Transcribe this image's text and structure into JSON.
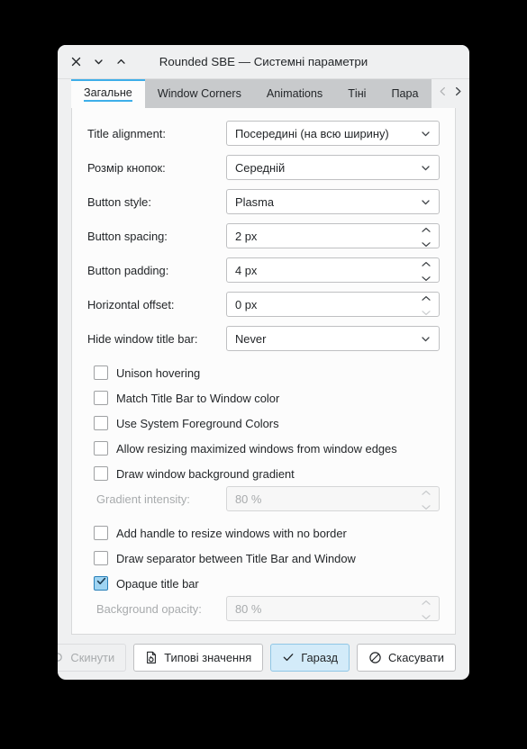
{
  "window": {
    "title": "Rounded SBE — Системні параметри",
    "controls": [
      {
        "name": "close",
        "glyph": "close-icon"
      },
      {
        "name": "minimize",
        "glyph": "chevron-down-icon"
      },
      {
        "name": "maximize",
        "glyph": "chevron-up-icon"
      }
    ]
  },
  "tabs": {
    "items": [
      {
        "label": "Загальне",
        "active": true
      },
      {
        "label": "Window Corners",
        "active": false
      },
      {
        "label": "Animations",
        "active": false
      },
      {
        "label": "Тіні",
        "active": false
      },
      {
        "label": "Пара",
        "active": false
      }
    ],
    "nav_prev": "chevron-left-icon",
    "nav_next": "chevron-right-icon"
  },
  "form": {
    "rows": [
      {
        "label": "Title alignment:",
        "value": "Посередині (на всю ширину)",
        "kind": "combo"
      },
      {
        "label": "Розмір кнопок:",
        "value": "Середній",
        "kind": "combo"
      },
      {
        "label": "Button style:",
        "value": "Plasma",
        "kind": "combo"
      },
      {
        "label": "Button spacing:",
        "value": "2 px",
        "kind": "spin"
      },
      {
        "label": "Button padding:",
        "value": "4 px",
        "kind": "spin"
      },
      {
        "label": "Horizontal offset:",
        "value": "0 px",
        "kind": "spin",
        "spin_down_disabled": true
      },
      {
        "label": "Hide window title bar:",
        "value": "Never",
        "kind": "combo"
      }
    ]
  },
  "checkboxes": {
    "group_a": [
      {
        "label": "Unison hovering",
        "checked": false
      },
      {
        "label": "Match Title Bar to Window color",
        "checked": false
      },
      {
        "label": "Use System Foreground Colors",
        "checked": false
      },
      {
        "label": "Allow resizing maximized windows from window edges",
        "checked": false
      },
      {
        "label": "Draw window background gradient",
        "checked": false
      }
    ],
    "gradient_intensity": {
      "label": "Gradient intensity:",
      "value": "80 %",
      "disabled": true
    },
    "group_b": [
      {
        "label": "Add handle to resize windows with no border",
        "checked": false
      },
      {
        "label": "Draw separator between Title Bar and Window",
        "checked": false
      },
      {
        "label": "Opaque title bar",
        "checked": true
      }
    ],
    "background_opacity": {
      "label": "Background opacity:",
      "value": "80 %",
      "disabled": true
    }
  },
  "footer": {
    "reset": {
      "label": "Скинути",
      "icon": "undo-icon",
      "disabled": true
    },
    "defaults": {
      "label": "Типові значення",
      "icon": "document-revert-icon",
      "disabled": false
    },
    "ok": {
      "label": "Гаразд",
      "icon": "check-icon",
      "primary": true
    },
    "cancel": {
      "label": "Скасувати",
      "icon": "cancel-icon",
      "primary": false
    }
  },
  "colors": {
    "accent": "#3daee9",
    "window_bg": "#eff0f1",
    "panel_bg": "#fcfcfc",
    "tab_inactive": "#c8cacc",
    "primary_btn": "#d3ebf9",
    "text": "#232629",
    "disabled_text": "#a8abad",
    "desktop": "#000000"
  }
}
